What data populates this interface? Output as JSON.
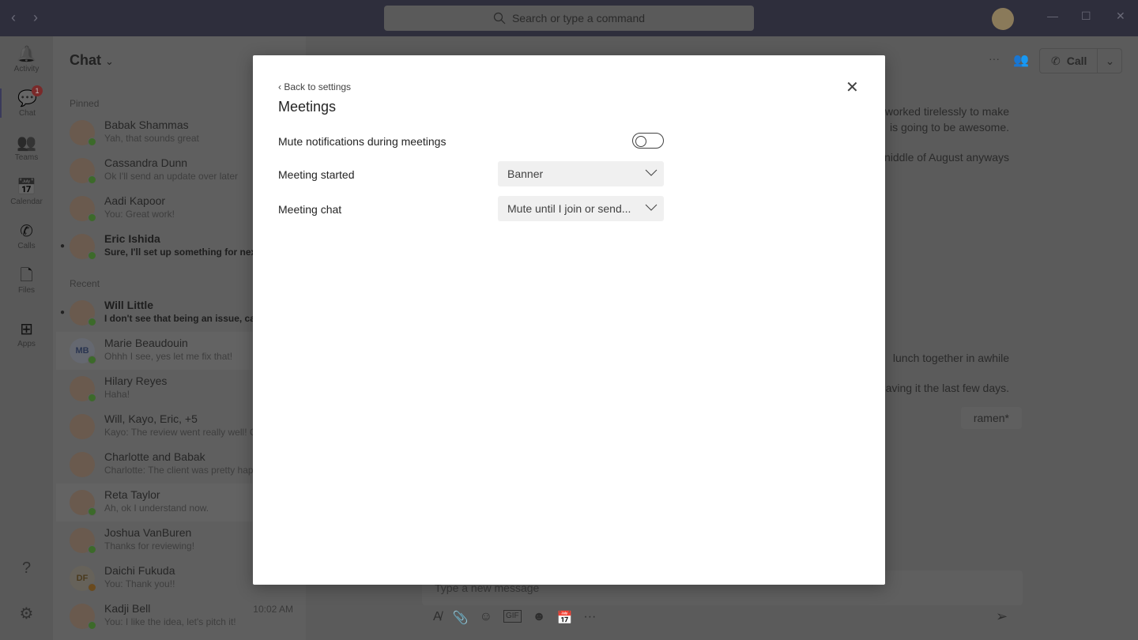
{
  "titlebar": {
    "search_placeholder": "Search or type a command"
  },
  "rail": [
    {
      "label": "Activity",
      "icon": "bell-icon",
      "glyph": "🔔"
    },
    {
      "label": "Chat",
      "icon": "chat-icon",
      "glyph": "💬",
      "badge": "1"
    },
    {
      "label": "Teams",
      "icon": "teams-icon",
      "glyph": "👥"
    },
    {
      "label": "Calendar",
      "icon": "calendar-icon",
      "glyph": "📅"
    },
    {
      "label": "Calls",
      "icon": "phone-icon",
      "glyph": "✆"
    },
    {
      "label": "Files",
      "icon": "file-icon",
      "glyph": "🗋"
    },
    {
      "label": "Apps",
      "icon": "apps-icon",
      "glyph": "⊞"
    }
  ],
  "chatlist": {
    "title": "Chat",
    "pinned_label": "Pinned",
    "recent_label": "Recent",
    "pinned": [
      {
        "name": "Babak Shammas",
        "preview": "Yah, that sounds great"
      },
      {
        "name": "Cassandra Dunn",
        "preview": "Ok I'll send an update over later"
      },
      {
        "name": "Aadi Kapoor",
        "preview": "You: Great work!"
      },
      {
        "name": "Eric Ishida",
        "preview": "Sure, I'll set up something for next",
        "unread": true
      }
    ],
    "recent": [
      {
        "name": "Will Little",
        "preview": "I don't see that being an issue, can",
        "unread": true
      },
      {
        "name": "Marie Beaudouin",
        "preview": "Ohhh I see, yes let me fix that!",
        "initials": "MB",
        "selected": true
      },
      {
        "name": "Hilary Reyes",
        "preview": "Haha!"
      },
      {
        "name": "Will, Kayo, Eric, +5",
        "preview": "Kayo: The review went really well! C",
        "group": true
      },
      {
        "name": "Charlotte and Babak",
        "preview": "Charlotte: The client was pretty hap",
        "group": true
      },
      {
        "name": "Reta Taylor",
        "preview": "Ah, ok I understand now.",
        "selected": true
      },
      {
        "name": "Joshua VanBuren",
        "preview": "Thanks for reviewing!"
      },
      {
        "name": "Daichi Fukuda",
        "preview": "You: Thank you!!",
        "initials": "DF",
        "away": true
      },
      {
        "name": "Kadji Bell",
        "preview": "You: I like the idea, let's pitch it!",
        "time": "10:02 AM"
      }
    ]
  },
  "conversation": {
    "call_label": "Call",
    "messages": [
      "worked tirelessly to make",
      "is going to be awesome.",
      "niddle of August anyways",
      "lunch together in awhile",
      "aving it the last few days.",
      "ramen*"
    ],
    "compose_placeholder": "Type a new message"
  },
  "dialog": {
    "back_label": "Back to settings",
    "title": "Meetings",
    "mute_label": "Mute notifications during meetings",
    "mute_on": false,
    "started_label": "Meeting started",
    "started_value": "Banner",
    "chat_label": "Meeting chat",
    "chat_value": "Mute until I join or send..."
  }
}
